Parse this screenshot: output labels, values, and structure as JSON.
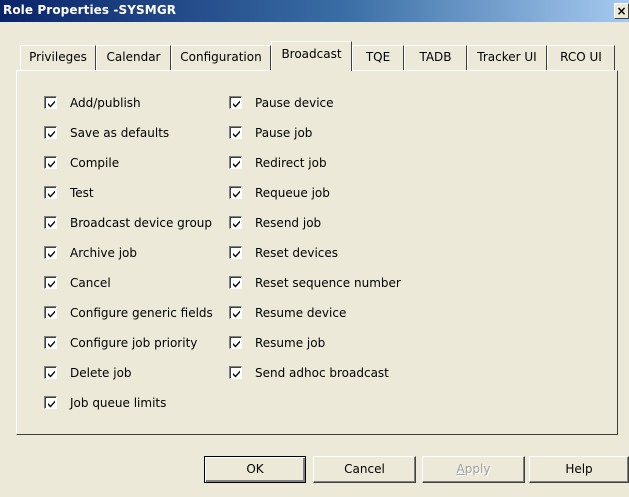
{
  "window": {
    "title": "Role Properties -SYSMGR",
    "close_glyph": "×"
  },
  "tabs": [
    {
      "label": "Privileges"
    },
    {
      "label": "Calendar"
    },
    {
      "label": "Configuration"
    },
    {
      "label": "Broadcast",
      "active": true
    },
    {
      "label": "TQE"
    },
    {
      "label": "TADB"
    },
    {
      "label": "Tracker UI"
    },
    {
      "label": "RCO UI"
    }
  ],
  "broadcast_permissions": {
    "left_column": [
      {
        "label": "Add/publish",
        "checked": true
      },
      {
        "label": "Save as defaults",
        "checked": true
      },
      {
        "label": "Compile",
        "checked": true
      },
      {
        "label": "Test",
        "checked": true
      },
      {
        "label": "Broadcast device group",
        "checked": true
      },
      {
        "label": "Archive job",
        "checked": true
      },
      {
        "label": "Cancel",
        "checked": true
      },
      {
        "label": "Configure generic fields",
        "checked": true
      },
      {
        "label": "Configure job priority",
        "checked": true
      },
      {
        "label": "Delete job",
        "checked": true
      },
      {
        "label": "Job queue limits",
        "checked": true
      }
    ],
    "right_column": [
      {
        "label": "Pause device",
        "checked": true
      },
      {
        "label": "Pause job",
        "checked": true
      },
      {
        "label": "Redirect job",
        "checked": true
      },
      {
        "label": "Requeue job",
        "checked": true
      },
      {
        "label": "Resend job",
        "checked": true
      },
      {
        "label": "Reset devices",
        "checked": true
      },
      {
        "label": "Reset sequence number",
        "checked": true
      },
      {
        "label": "Resume device",
        "checked": true
      },
      {
        "label": "Resume job",
        "checked": true
      },
      {
        "label": "Send adhoc broadcast",
        "checked": true
      }
    ]
  },
  "buttons": {
    "ok": "OK",
    "cancel": "Cancel",
    "apply_mnemonic": "A",
    "apply_rest": "pply",
    "help": "Help"
  },
  "colors": {
    "dialog_bg": "#ece9d8",
    "title_bar_start": "#0a246a",
    "title_bar_end": "#a6caf0",
    "title_text": "#ffffff",
    "disabled_text": "#a0a0a0"
  }
}
